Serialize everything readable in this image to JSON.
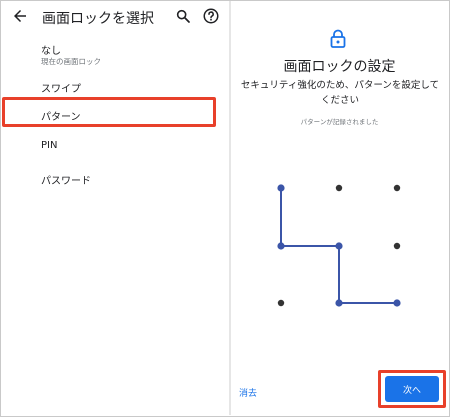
{
  "app_bar": {
    "title": "画面ロックを選択",
    "back_icon": "arrow-back-icon",
    "search_icon": "search-icon",
    "help_icon": "help-icon"
  },
  "lock_options": [
    {
      "label": "なし",
      "sub": "現在の画面ロック"
    },
    {
      "label": "スワイプ"
    },
    {
      "label": "パターン",
      "highlighted": true
    },
    {
      "label": "PIN"
    },
    {
      "label": "パスワード"
    }
  ],
  "setup": {
    "lock_icon": "lock-icon",
    "title": "画面ロックの設定",
    "description": "セキュリティ強化のため、パターンを設定してください",
    "status": "パターンが記録されました",
    "pattern_sequence": [
      1,
      4,
      5,
      8,
      9
    ],
    "clear_label": "消去",
    "next_label": "次へ"
  },
  "colors": {
    "accent": "#1a73e8",
    "pattern_line": "#3b55a8",
    "highlight": "#e8402a",
    "dot": "#333333"
  }
}
